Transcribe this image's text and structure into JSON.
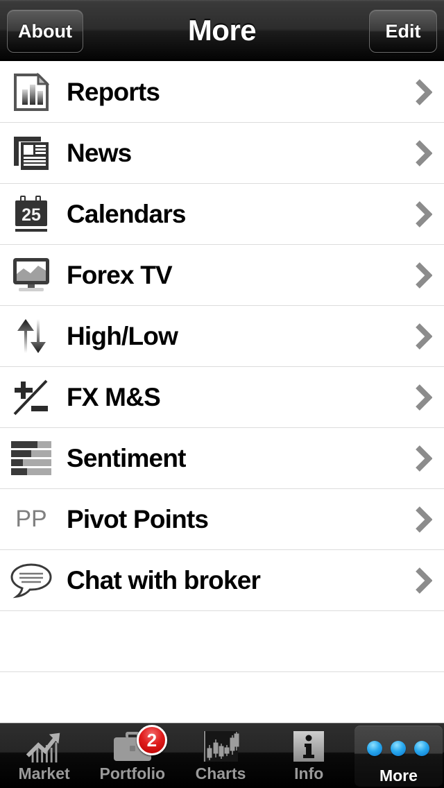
{
  "navbar": {
    "title": "More",
    "left_button": "About",
    "right_button": "Edit"
  },
  "list": {
    "items": [
      {
        "label": "Reports",
        "icon": "report-document-icon"
      },
      {
        "label": "News",
        "icon": "newspaper-icon"
      },
      {
        "label": "Calendars",
        "icon": "calendar-25-icon"
      },
      {
        "label": "Forex TV",
        "icon": "television-icon"
      },
      {
        "label": "High/Low",
        "icon": "up-down-arrows-icon"
      },
      {
        "label": "FX M&S",
        "icon": "plus-minus-icon"
      },
      {
        "label": "Sentiment",
        "icon": "sentiment-bars-icon"
      },
      {
        "label": "Pivot Points",
        "icon": "pp-text-icon",
        "icon_text": "PP"
      },
      {
        "label": "Chat with broker",
        "icon": "chat-bubble-icon"
      }
    ],
    "empty_rows": 2,
    "chevron_color": "#8c8c8c",
    "separator_color": "#dcdcdc"
  },
  "tabbar": {
    "tabs": [
      {
        "label": "Market",
        "icon": "market-trend-icon",
        "selected": false,
        "badge": ""
      },
      {
        "label": "Portfolio",
        "icon": "briefcase-icon",
        "selected": false,
        "badge": "2"
      },
      {
        "label": "Charts",
        "icon": "candlestick-icon",
        "selected": false,
        "badge": ""
      },
      {
        "label": "Info",
        "icon": "info-i-icon",
        "selected": false,
        "badge": ""
      },
      {
        "label": "More",
        "icon": "three-dots-icon",
        "selected": true,
        "badge": ""
      }
    ],
    "badge_color": "#e01c1c",
    "dot_color": "#29a9ef",
    "selected_label_color": "#ffffff",
    "label_color": "#9a9a9a"
  }
}
